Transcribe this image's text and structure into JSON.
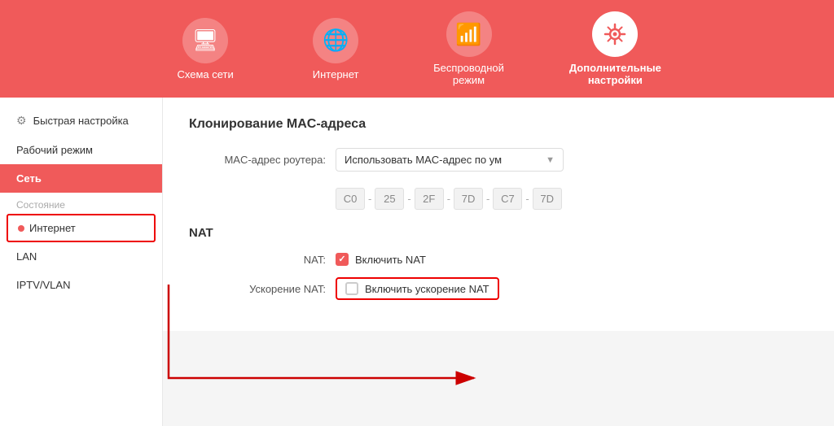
{
  "topNav": {
    "items": [
      {
        "id": "schema",
        "label": "Схема сети",
        "icon": "🖥",
        "active": false
      },
      {
        "id": "internet",
        "label": "Интернет",
        "icon": "🌐",
        "active": false
      },
      {
        "id": "wireless",
        "label": "Беспроводной\nрежим",
        "icon": "📶",
        "active": false
      },
      {
        "id": "advanced",
        "label": "Дополнительные\nнастройки",
        "icon": "⚙",
        "active": true
      }
    ]
  },
  "sidebar": {
    "items": [
      {
        "id": "quick",
        "label": "Быстрая настройка",
        "icon": "⚙",
        "type": "parent"
      },
      {
        "id": "workmode",
        "label": "Рабочий режим",
        "type": "top"
      },
      {
        "id": "network",
        "label": "Сеть",
        "type": "active"
      },
      {
        "id": "status",
        "label": "Состояние",
        "type": "section"
      },
      {
        "id": "inet",
        "label": "Интернет",
        "type": "sub-selected"
      },
      {
        "id": "lan",
        "label": "LAN",
        "type": "sub"
      },
      {
        "id": "iptv",
        "label": "IPTV/VLAN",
        "type": "sub"
      }
    ]
  },
  "content": {
    "macSection": {
      "title": "Клонирование MAC-адреса",
      "macLabel": "MAC-адрес роутера:",
      "macDropdownValue": "Использовать MAC-адрес по ум",
      "macAddress": [
        "C0",
        "25",
        "2F",
        "7D",
        "C7",
        "7D"
      ]
    },
    "natSection": {
      "title": "NAT",
      "natLabel": "NAT:",
      "natCheckboxLabel": "Включить NAT",
      "natChecked": true,
      "accelLabel": "Ускорение NAT:",
      "accelCheckboxLabel": "Включить ускорение NAT",
      "accelChecked": false
    }
  }
}
